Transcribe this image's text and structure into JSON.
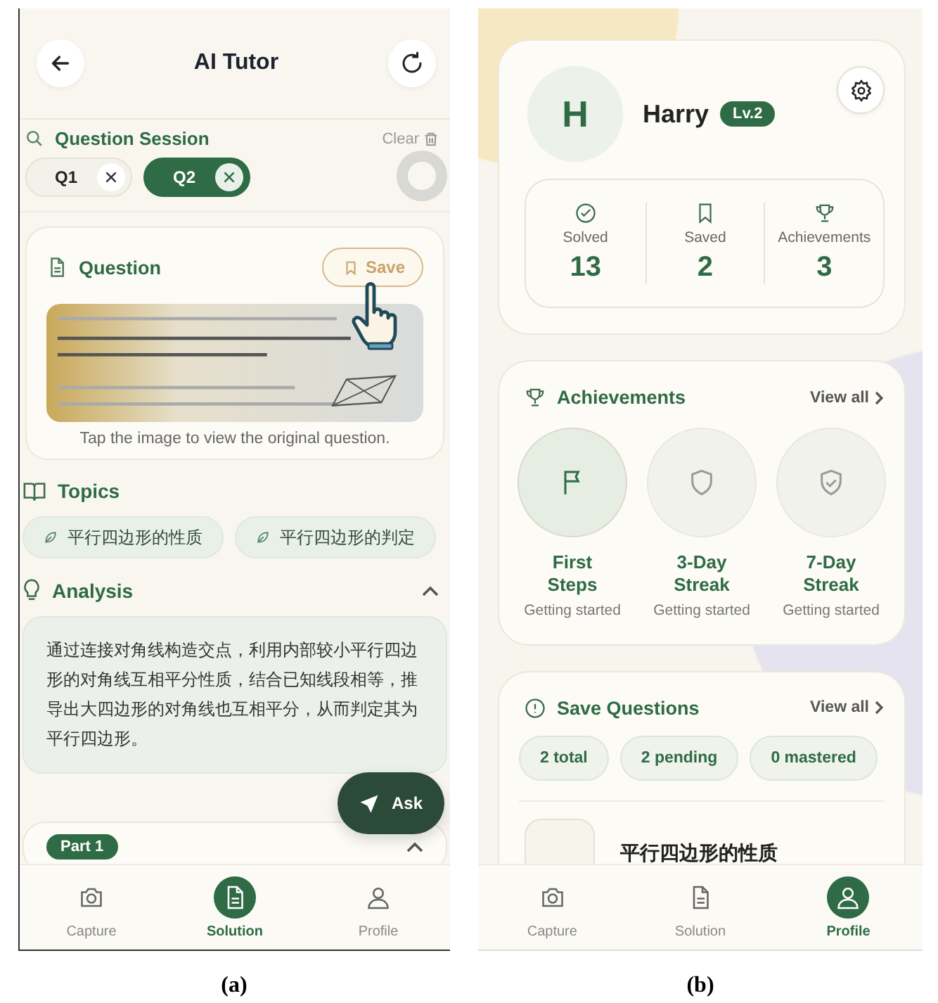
{
  "panel_a": {
    "header": {
      "title": "AI Tutor"
    },
    "session": {
      "title": "Question Session",
      "clear": "Clear",
      "tabs": [
        {
          "label": "Q1",
          "selected": false
        },
        {
          "label": "Q2",
          "selected": true
        }
      ]
    },
    "question": {
      "title": "Question",
      "save": "Save",
      "caption": "Tap the image to view the original question."
    },
    "topics": {
      "title": "Topics",
      "items": [
        "平行四边形的性质",
        "平行四边形的判定"
      ]
    },
    "analysis": {
      "title": "Analysis",
      "expanded": true,
      "text": "通过连接对角线构造交点，利用内部较小平行四边形的对角线互相平分性质，结合已知线段相等，推导出大四边形的对角线也互相平分，从而判定其为平行四边形。"
    },
    "part": {
      "label": "Part 1",
      "expanded": true
    },
    "ask": "Ask",
    "nav": [
      {
        "label": "Capture",
        "kind": "camera",
        "selected": false
      },
      {
        "label": "Solution",
        "kind": "document",
        "selected": true
      },
      {
        "label": "Profile",
        "kind": "person",
        "selected": false
      }
    ],
    "caption": "(a)"
  },
  "panel_b": {
    "profile": {
      "initial": "H",
      "name": "Harry",
      "level": "Lv.2"
    },
    "stats": [
      {
        "label": "Solved",
        "value": "13",
        "kind": "check"
      },
      {
        "label": "Saved",
        "value": "2",
        "kind": "bookmark"
      },
      {
        "label": "Achievements",
        "value": "3",
        "kind": "trophy"
      }
    ],
    "achievements": {
      "title": "Achievements",
      "view_all": "View all",
      "items": [
        {
          "title": "First Steps",
          "subtitle": "Getting started",
          "kind": "flag",
          "earned": true
        },
        {
          "title": "3-Day Streak",
          "subtitle": "Getting started",
          "kind": "shield",
          "earned": false
        },
        {
          "title": "7-Day Streak",
          "subtitle": "Getting started",
          "kind": "shield-check",
          "earned": false
        }
      ]
    },
    "saved": {
      "title": "Save Questions",
      "view_all": "View all",
      "chips": [
        "2 total",
        "2 pending",
        "0 mastered"
      ],
      "items": [
        {
          "title": "平行四边形的性质"
        }
      ]
    },
    "nav": [
      {
        "label": "Capture",
        "kind": "camera",
        "selected": false
      },
      {
        "label": "Solution",
        "kind": "document",
        "selected": false
      },
      {
        "label": "Profile",
        "kind": "person",
        "selected": true
      }
    ],
    "caption": "(b)"
  }
}
